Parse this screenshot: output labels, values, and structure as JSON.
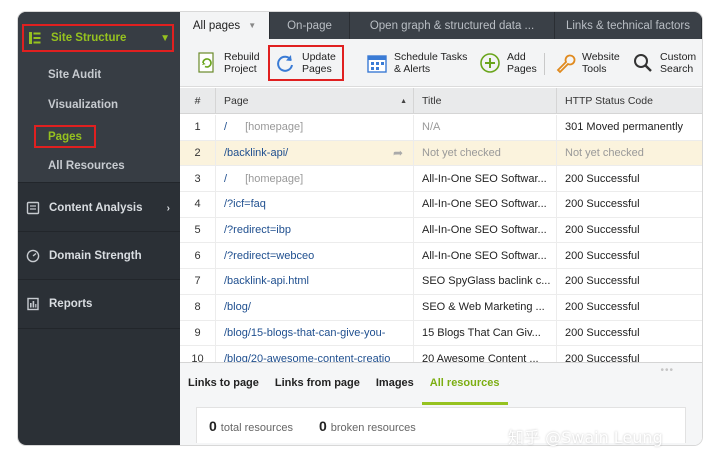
{
  "sidebar": {
    "site_structure": {
      "label": "Site Structure"
    },
    "items": [
      {
        "label": "Site Audit"
      },
      {
        "label": "Visualization"
      },
      {
        "label": "Pages"
      },
      {
        "label": "All Resources"
      }
    ],
    "groups": [
      {
        "label": "Content Analysis"
      },
      {
        "label": "Domain Strength"
      },
      {
        "label": "Reports"
      }
    ]
  },
  "tabs": [
    {
      "label": "All pages"
    },
    {
      "label": "On-page"
    },
    {
      "label": "Open graph & structured data ..."
    },
    {
      "label": "Links & technical factors"
    }
  ],
  "toolbar": {
    "rebuild": {
      "line1": "Rebuild",
      "line2": "Project"
    },
    "update": {
      "line1": "Update",
      "line2": "Pages"
    },
    "schedule": {
      "line1": "Schedule Tasks",
      "line2": "& Alerts"
    },
    "add": {
      "line1": "Add",
      "line2": "Pages"
    },
    "tools": {
      "line1": "Website",
      "line2": "Tools"
    },
    "search": {
      "line1": "Custom",
      "line2": "Search"
    }
  },
  "table": {
    "columns": [
      "#",
      "Page",
      "Title",
      "HTTP Status Code"
    ],
    "rows": [
      {
        "num": "1",
        "page": "/",
        "extra": "[homepage]",
        "title": "N/A",
        "status": "301 Moved permanently"
      },
      {
        "num": "2",
        "page": "/backlink-api/",
        "extra": "",
        "title": "Not yet checked",
        "status": "Not yet checked"
      },
      {
        "num": "3",
        "page": "/",
        "extra": "[homepage]",
        "title": "All-In-One SEO Softwar...",
        "status": "200 Successful"
      },
      {
        "num": "4",
        "page": "/?icf=faq",
        "extra": "",
        "title": "All-In-One SEO Softwar...",
        "status": "200 Successful"
      },
      {
        "num": "5",
        "page": "/?redirect=ibp",
        "extra": "",
        "title": "All-In-One SEO Softwar...",
        "status": "200 Successful"
      },
      {
        "num": "6",
        "page": "/?redirect=webceo",
        "extra": "",
        "title": "All-In-One SEO Softwar...",
        "status": "200 Successful"
      },
      {
        "num": "7",
        "page": "/backlink-api.html",
        "extra": "",
        "title": "SEO SpyGlass baclink c...",
        "status": "200 Successful"
      },
      {
        "num": "8",
        "page": "/blog/",
        "extra": "",
        "title": "SEO & Web Marketing ...",
        "status": "200 Successful"
      },
      {
        "num": "9",
        "page": "/blog/15-blogs-that-can-give-you-",
        "extra": "",
        "title": "15 Blogs That Can Giv...",
        "status": "200 Successful"
      },
      {
        "num": "10",
        "page": "/blog/20-awesome-content-creatio",
        "extra": "",
        "title": "20 Awesome Content ...",
        "status": "200 Successful"
      }
    ]
  },
  "bottom": {
    "tabs": [
      {
        "label": "Links to page"
      },
      {
        "label": "Links from page"
      },
      {
        "label": "Images"
      },
      {
        "label": "All resources"
      }
    ],
    "total": {
      "count": "0",
      "label": "total resources"
    },
    "broken": {
      "count": "0",
      "label": "broken resources"
    }
  },
  "watermark": "知乎 @Swain Leung",
  "colors": {
    "accent": "#96c21f",
    "highlight_box": "#e02020",
    "sidebar_bg": "#2b3036"
  }
}
